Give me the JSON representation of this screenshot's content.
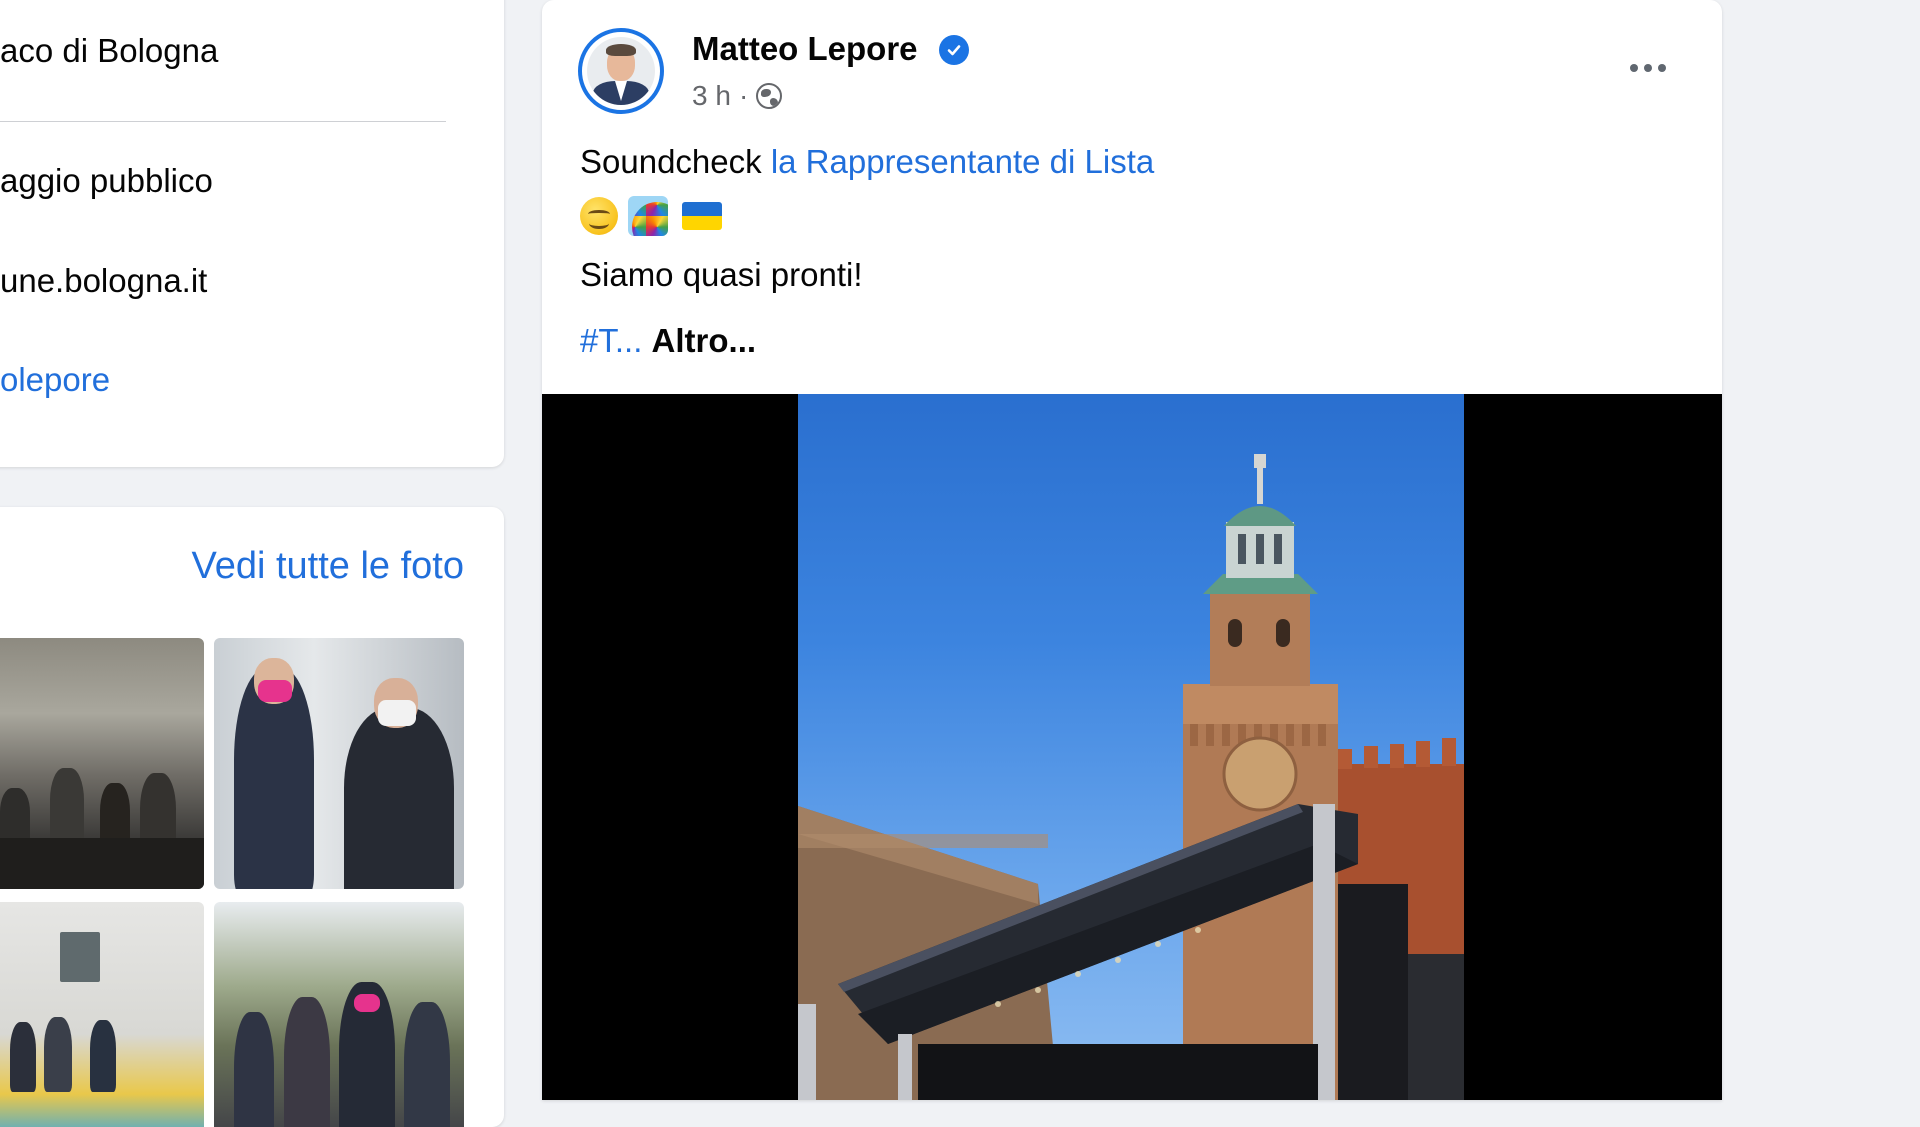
{
  "intro": {
    "role": "aco di Bologna",
    "category": "aggio pubblico",
    "website": "une.bologna.it",
    "social": "olepore"
  },
  "photos": {
    "see_all_label": "Vedi tutte le foto"
  },
  "post": {
    "author": "Matteo Lepore",
    "time": "3 h",
    "separator": "·",
    "text_prefix": "Soundcheck",
    "mention": "la Rappresentante di Lista",
    "emojis": [
      "😊",
      "🌈",
      "🇺🇦"
    ],
    "line2": "Siamo quasi pronti!",
    "hashtag_truncated": "#T...",
    "see_more_label": "Altro..."
  },
  "colors": {
    "link": "#216fdb",
    "verified": "#1b74e4",
    "background": "#f0f2f5"
  },
  "icons": [
    "verified-badge-icon",
    "globe-icon",
    "more-options-icon"
  ]
}
